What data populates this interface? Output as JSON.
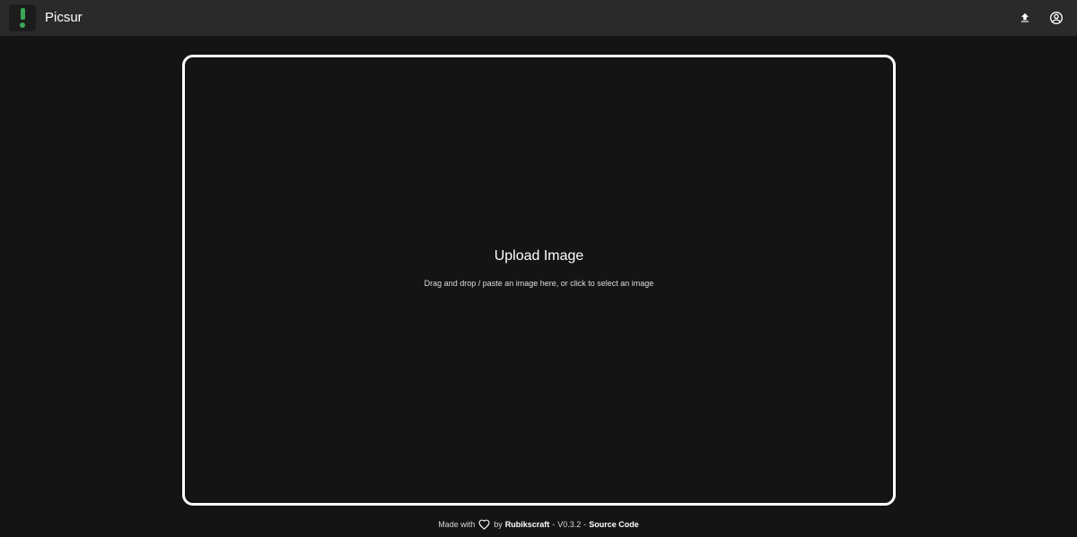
{
  "header": {
    "app_title": "Picsur",
    "logo_icon": "exclamation-logo-icon",
    "accent_color": "#3aa655",
    "upload_icon": "upload-icon",
    "account_icon": "account-circle-icon"
  },
  "dropzone": {
    "title": "Upload Image",
    "hint": "Drag and drop / paste an image here, or click to select an image"
  },
  "footer": {
    "made_with": "Made with",
    "heart_icon": "heart-icon",
    "by": "by",
    "author": "Rubikscraft",
    "separator1": "-",
    "version": "V0.3.2",
    "separator2": "-",
    "source_code": "Source Code"
  }
}
